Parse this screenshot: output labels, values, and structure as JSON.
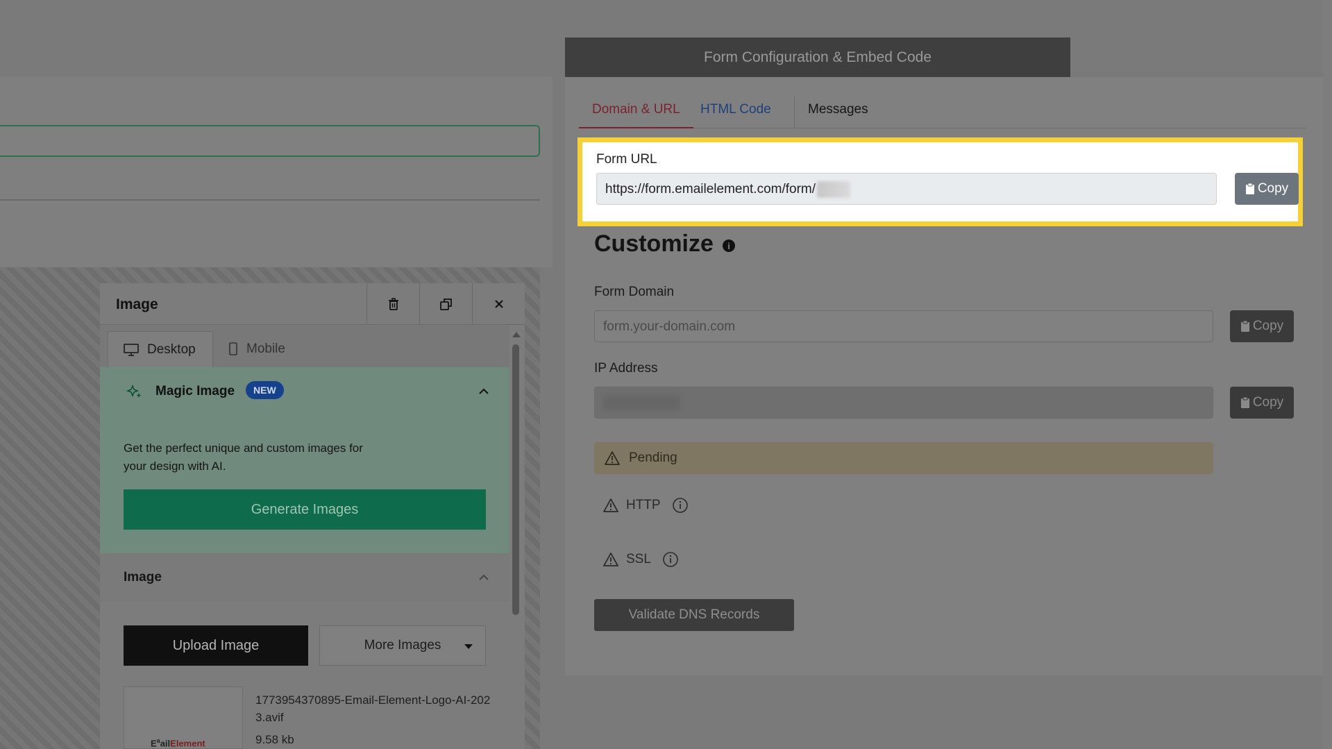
{
  "left_editor": {
    "panel_title": "Image",
    "tabs": {
      "desktop": "Desktop",
      "mobile": "Mobile"
    },
    "magic": {
      "title": "Magic Image",
      "badge": "NEW",
      "description": "Get the perfect unique and custom images for your design with AI.",
      "generate_label": "Generate Images"
    },
    "image_section_title": "Image",
    "upload_label": "Upload Image",
    "more_images_label": "More Images",
    "thumb_logo": {
      "part1": "E",
      "mark": "a",
      "part2": "ail",
      "part3": "Element"
    },
    "file": {
      "name": "1773954370895-Email-Element-Logo-AI-2023.avif",
      "size": "9.58 kb"
    }
  },
  "config": {
    "header": "Form Configuration & Embed Code",
    "tabs": [
      "Domain & URL",
      "HTML Code",
      "Messages"
    ],
    "form_url": {
      "label": "Form URL",
      "value": "https://form.emailelement.com/form/",
      "copy": "Copy"
    },
    "customize_title": "Customize",
    "info_symbol": "i",
    "form_domain": {
      "label": "Form Domain",
      "placeholder": "form.your-domain.com",
      "copy": "Copy"
    },
    "ip_address": {
      "label": "IP Address",
      "copy": "Copy"
    },
    "status": {
      "pending": "Pending",
      "http": "HTTP",
      "ssl": "SSL"
    },
    "validate_label": "Validate DNS Records"
  },
  "colors": {
    "highlight": "#f5d036",
    "active_tab": "#c0392b",
    "link_tab": "#1a56db",
    "generate_btn": "#16a37a"
  }
}
